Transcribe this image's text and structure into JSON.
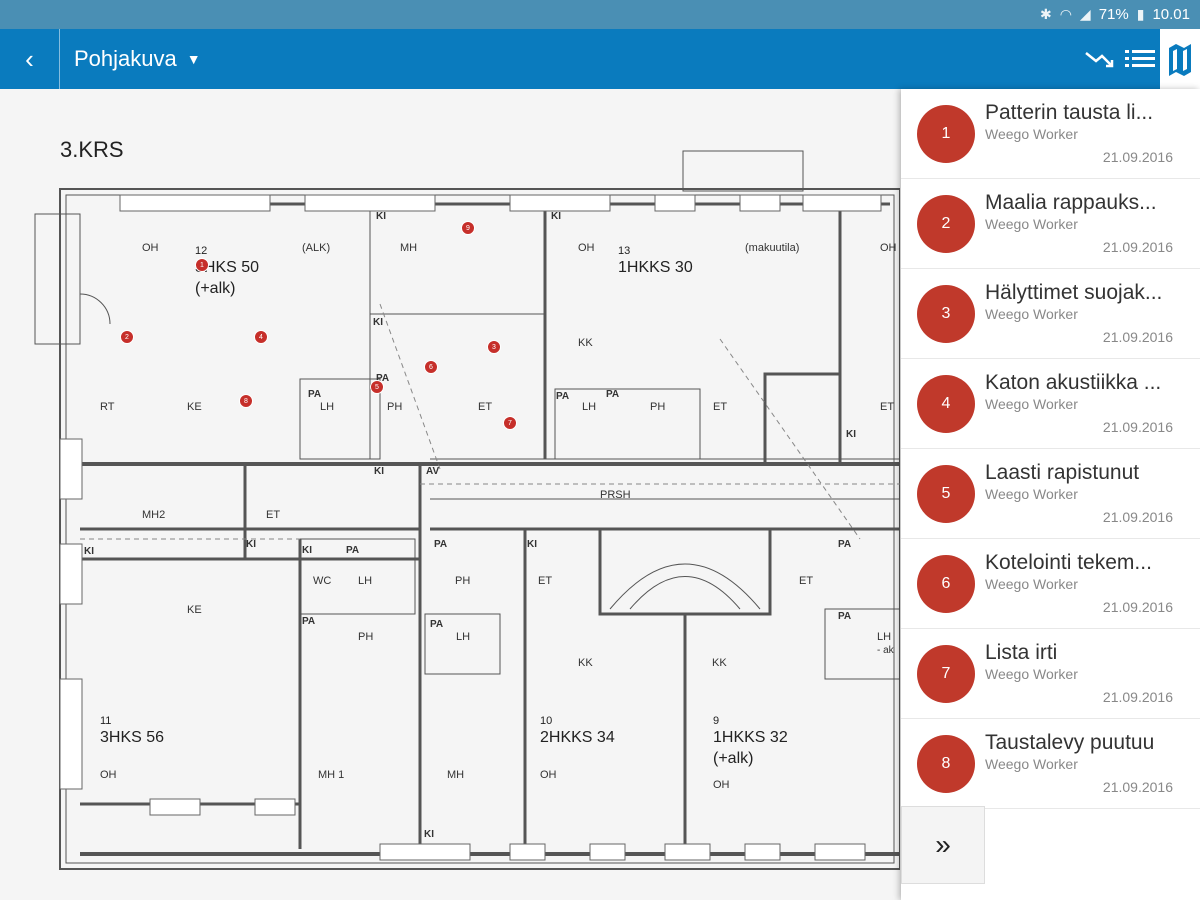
{
  "status": {
    "battery": "71%",
    "time": "10.01"
  },
  "header": {
    "title": "Pohjakuva"
  },
  "plan": {
    "floor": "3.KRS",
    "rooms": [
      "OH",
      "(ALK)",
      "MH",
      "OH",
      "(makuutila)",
      "OH",
      "RT",
      "KE",
      "LH",
      "PH",
      "ET",
      "LH",
      "PH",
      "ET",
      "ET",
      "MH2",
      "ET",
      "PRSH",
      "WC",
      "LH",
      "PH",
      "PH",
      "ET",
      "ET",
      "KE",
      "LH",
      "KK",
      "KK",
      "KK",
      "OH",
      "MH 1",
      "MH",
      "OH",
      "OH",
      "LH",
      "PA",
      "PA",
      "PA",
      "PA",
      "PA",
      "PA",
      "PA",
      "PA",
      "PA",
      "PA",
      "KI",
      "KI",
      "KI",
      "KI",
      "KI",
      "KI",
      "KI",
      "KI",
      "KI",
      "KI",
      "AV",
      "- ak"
    ],
    "units": [
      {
        "no": "12",
        "name": "3HKS 50",
        "sub": "(+alk)"
      },
      {
        "no": "13",
        "name": "1HKKS 30",
        "sub": ""
      },
      {
        "no": "11",
        "name": "3HKS 56",
        "sub": ""
      },
      {
        "no": "10",
        "name": "2HKKS 34",
        "sub": ""
      },
      {
        "no": "9",
        "name": "1HKKS 32",
        "sub": "(+alk)"
      }
    ]
  },
  "list": [
    {
      "num": "1",
      "title": "Patterin tausta li...",
      "worker": "Weego Worker",
      "date": "21.09.2016"
    },
    {
      "num": "2",
      "title": "Maalia rappauks...",
      "worker": "Weego Worker",
      "date": "21.09.2016"
    },
    {
      "num": "3",
      "title": "Hälyttimet suojak...",
      "worker": "Weego Worker",
      "date": "21.09.2016"
    },
    {
      "num": "4",
      "title": "Katon akustiikka ...",
      "worker": "Weego Worker",
      "date": "21.09.2016"
    },
    {
      "num": "5",
      "title": "Laasti rapistunut",
      "worker": "Weego Worker",
      "date": "21.09.2016"
    },
    {
      "num": "6",
      "title": "Kotelointi tekem...",
      "worker": "Weego Worker",
      "date": "21.09.2016"
    },
    {
      "num": "7",
      "title": "Lista irti",
      "worker": "Weego Worker",
      "date": "21.09.2016"
    },
    {
      "num": "8",
      "title": "Taustalevy puutuu",
      "worker": "Weego Worker",
      "date": "21.09.2016"
    }
  ],
  "pins": [
    "1",
    "2",
    "3",
    "4",
    "5",
    "6",
    "7",
    "8",
    "9"
  ],
  "more_label": "»",
  "colors": {
    "appbar": "#0a7bbe",
    "status": "#4a8fb4",
    "marker": "#c0392b"
  },
  "icons": [
    "bluetooth-icon",
    "wifi-icon",
    "signal-icon",
    "battery-icon",
    "back-icon",
    "chevron-down-icon",
    "trend-down-icon",
    "list-icon",
    "map-icon"
  ]
}
